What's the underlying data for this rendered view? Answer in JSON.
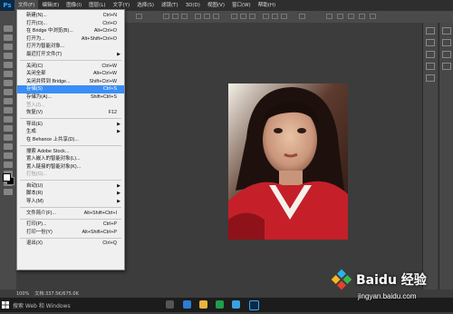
{
  "app": {
    "logo": "Ps"
  },
  "menubar": {
    "items": [
      "文件(F)",
      "编辑(E)",
      "图像(I)",
      "图层(L)",
      "文字(Y)",
      "选择(S)",
      "滤镜(T)",
      "3D(D)",
      "视图(V)",
      "窗口(W)",
      "帮助(H)"
    ]
  },
  "file_menu": {
    "new": {
      "label": "新建(N)...",
      "shortcut": "Ctrl+N"
    },
    "open": {
      "label": "打开(O)...",
      "shortcut": "Ctrl+O"
    },
    "browse_bridge": {
      "label": "在 Bridge 中浏览(B)...",
      "shortcut": "Alt+Ctrl+O"
    },
    "open_as": {
      "label": "打开为...",
      "shortcut": "Alt+Shift+Ctrl+O"
    },
    "open_smart": {
      "label": "打开为智能对象..."
    },
    "recent": {
      "label": "最近打开文件(T)"
    },
    "close": {
      "label": "关闭(C)",
      "shortcut": "Ctrl+W"
    },
    "close_all": {
      "label": "关闭全部",
      "shortcut": "Alt+Ctrl+W"
    },
    "close_bridge": {
      "label": "关闭并转到 Bridge...",
      "shortcut": "Shift+Ctrl+W"
    },
    "save": {
      "label": "存储(S)",
      "shortcut": "Ctrl+S"
    },
    "save_as": {
      "label": "存储为(A)...",
      "shortcut": "Shift+Ctrl+S"
    },
    "checkin": {
      "label": "签入(I)..."
    },
    "revert": {
      "label": "恢复(V)",
      "shortcut": "F12"
    },
    "export": {
      "label": "导出(E)"
    },
    "generate": {
      "label": "生成"
    },
    "behance": {
      "label": "在 Behance 上共享(D)..."
    },
    "search_stock": {
      "label": "搜索 Adobe Stock..."
    },
    "place_embedded": {
      "label": "置入嵌入的智能对象(L)..."
    },
    "place_linked": {
      "label": "置入链接的智能对象(K)..."
    },
    "package": {
      "label": "打包(G)..."
    },
    "automate": {
      "label": "自动(U)"
    },
    "scripts": {
      "label": "脚本(R)"
    },
    "import": {
      "label": "导入(M)"
    },
    "file_info": {
      "label": "文件简介(F)...",
      "shortcut": "Alt+Shift+Ctrl+I"
    },
    "print": {
      "label": "打印(P)...",
      "shortcut": "Ctrl+P"
    },
    "print_one": {
      "label": "打印一份(Y)",
      "shortcut": "Alt+Shift+Ctrl+P"
    },
    "exit": {
      "label": "退出(X)",
      "shortcut": "Ctrl+Q"
    }
  },
  "status": {
    "zoom": "100%",
    "doc": "文档:337.5K/675.0K"
  },
  "taskbar": {
    "search_text": "搜索 Web 和 Windows"
  },
  "watermark": {
    "brand": "Baidu 经验",
    "url": "jingyan.baidu.com"
  },
  "colors": {
    "highlight": "#3a8ef6",
    "menubar": "#2e2e2e",
    "workspace": "#3c3c3c"
  }
}
